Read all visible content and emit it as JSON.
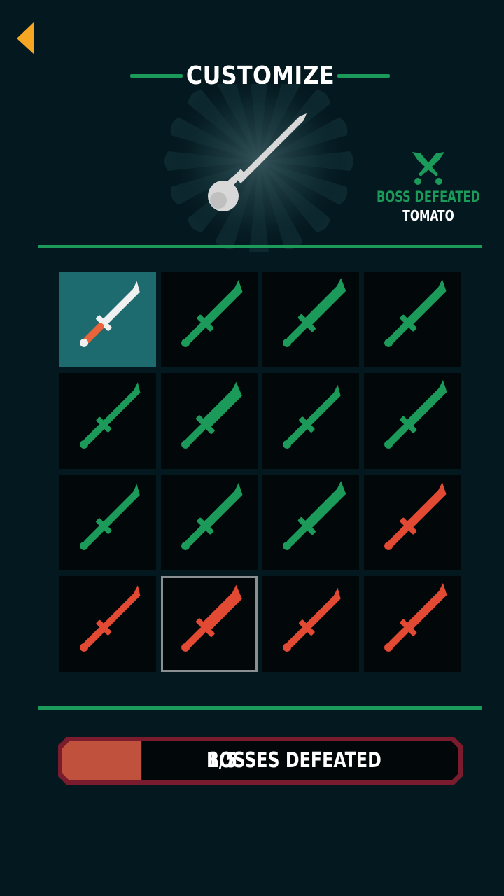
{
  "header": {
    "title": "CUSTOMIZE",
    "accent_color": "#1b9a5a",
    "back_icon": "chevron-left-icon",
    "back_color": "#f5a623"
  },
  "preview": {
    "weapon": "white-ladle-knife-icon",
    "boss_icon": "crossed-swords-icon",
    "boss_label": "BOSS DEFEATED",
    "boss_name": "TOMATO"
  },
  "knives": {
    "unlocked_color": "#f0f0f0",
    "green_color": "#1b9a5a",
    "red_color": "#e34a33",
    "items": [
      {
        "name": "hunting-knife-icon",
        "color": "unlocked",
        "state": "active"
      },
      {
        "name": "combat-knife-icon",
        "color": "green",
        "state": "locked"
      },
      {
        "name": "ornate-dagger-icon",
        "color": "green",
        "state": "locked"
      },
      {
        "name": "bowie-knife-icon",
        "color": "green",
        "state": "locked"
      },
      {
        "name": "curved-sword-icon",
        "color": "green",
        "state": "locked"
      },
      {
        "name": "cleaver-blade-icon",
        "color": "green",
        "state": "locked"
      },
      {
        "name": "spiked-dagger-icon",
        "color": "green",
        "state": "locked"
      },
      {
        "name": "short-sword-icon",
        "color": "green",
        "state": "locked"
      },
      {
        "name": "machete-icon",
        "color": "green",
        "state": "locked"
      },
      {
        "name": "kitchen-knife-icon",
        "color": "green",
        "state": "locked"
      },
      {
        "name": "stiletto-icon",
        "color": "green",
        "state": "locked"
      },
      {
        "name": "beaded-dagger-icon",
        "color": "red",
        "state": "locked"
      },
      {
        "name": "crossguard-sword-icon",
        "color": "red",
        "state": "locked"
      },
      {
        "name": "ladle-knife-icon",
        "color": "red",
        "state": "selected"
      },
      {
        "name": "knuckle-knife-icon",
        "color": "red",
        "state": "locked"
      },
      {
        "name": "katana-icon",
        "color": "red",
        "state": "locked"
      }
    ]
  },
  "progress": {
    "count": "1/5",
    "fraction": 0.2,
    "label": "BOSSES DEFEATED",
    "fill_color": "#c0513d",
    "frame_color": "#7a1b2e",
    "bg_color": "#020709"
  }
}
